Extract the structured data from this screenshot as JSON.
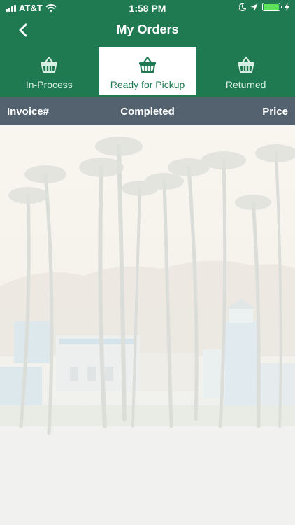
{
  "status_bar": {
    "carrier": "AT&T",
    "time": "1:58 PM",
    "icons": [
      "signal-icon",
      "wifi-icon",
      "moon-icon",
      "location-arrow-icon",
      "battery-icon",
      "charging-bolt-icon"
    ]
  },
  "nav": {
    "title": "My Orders",
    "back_icon": "chevron-left-icon"
  },
  "tabs": [
    {
      "label": "In-Process",
      "icon": "basket-icon",
      "active": false
    },
    {
      "label": "Ready for Pickup",
      "icon": "basket-icon",
      "active": true
    },
    {
      "label": "Returned",
      "icon": "basket-icon",
      "active": false
    }
  ],
  "table": {
    "columns": [
      "Invoice#",
      "Completed",
      "Price"
    ],
    "rows": []
  },
  "background": {
    "description_icon": "palm-trees-beach-photo"
  },
  "colors": {
    "brand_green": "#1f7a52",
    "header_gray": "#546270",
    "battery_green": "#5ee35a"
  }
}
